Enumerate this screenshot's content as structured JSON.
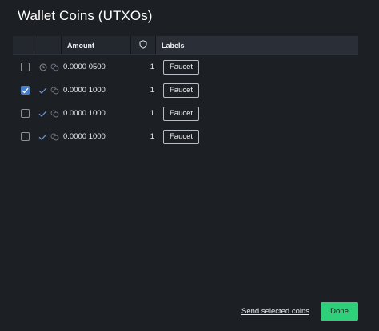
{
  "dialog": {
    "title": "Wallet Coins (UTXOs)"
  },
  "table": {
    "headers": {
      "amount": "Amount",
      "shield": "shield-icon",
      "labels": "Labels"
    },
    "rows": [
      {
        "checked": false,
        "status_icon": "clock-icon",
        "coin_icon": "coins-icon",
        "amount": "0.0000 0500",
        "count": "1",
        "label": "Faucet"
      },
      {
        "checked": true,
        "status_icon": "check-icon",
        "coin_icon": "coins-icon",
        "amount": "0.0000 1000",
        "count": "1",
        "label": "Faucet"
      },
      {
        "checked": false,
        "status_icon": "check-icon",
        "coin_icon": "coins-icon",
        "amount": "0.0000 1000",
        "count": "1",
        "label": "Faucet"
      },
      {
        "checked": false,
        "status_icon": "check-icon",
        "coin_icon": "coins-icon",
        "amount": "0.0000 1000",
        "count": "1",
        "label": "Faucet"
      }
    ]
  },
  "footer": {
    "send_link": "Send selected coins",
    "done_button": "Done"
  },
  "colors": {
    "background": "#1c1f24",
    "accent_checkbox": "#4a7fc8",
    "done_button": "#2fd07a"
  }
}
